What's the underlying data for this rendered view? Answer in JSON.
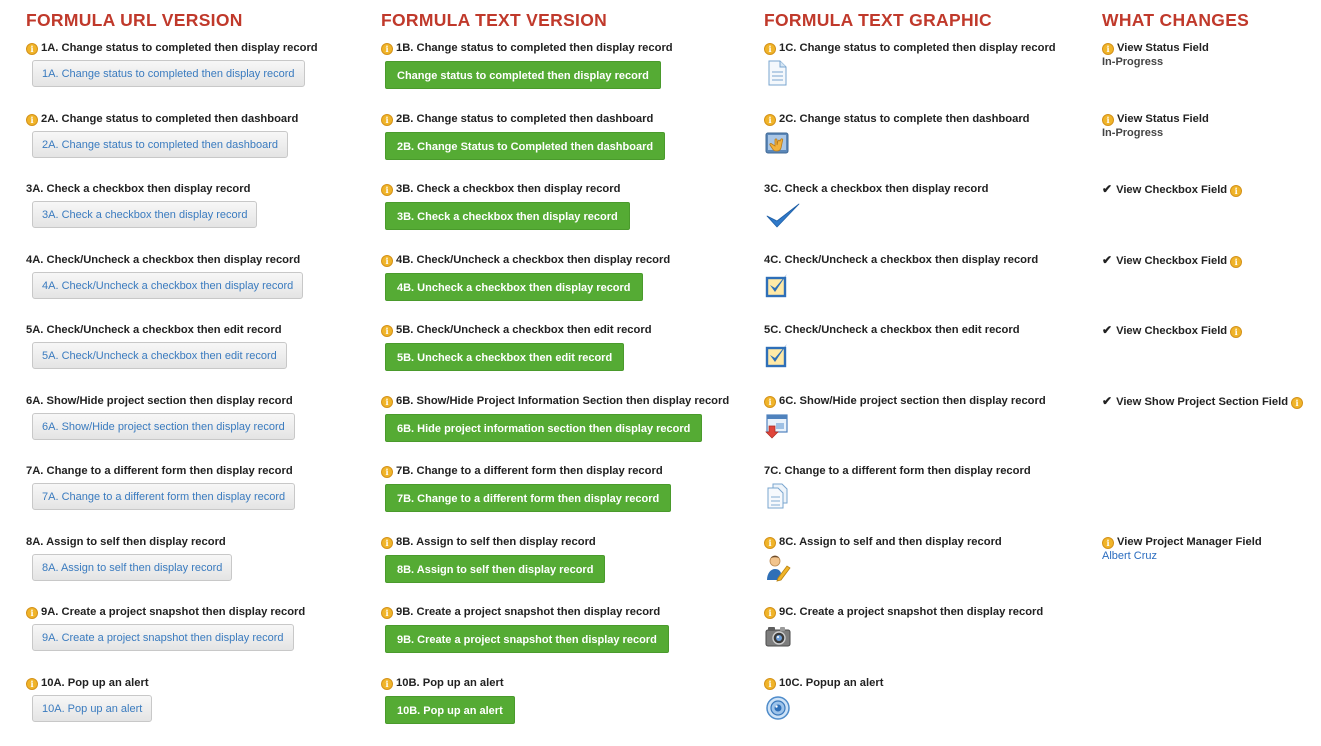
{
  "columns": {
    "url": {
      "title": "FORMULA URL VERSION"
    },
    "text": {
      "title": "FORMULA TEXT VERSION"
    },
    "graphic": {
      "title": "FORMULA TEXT GRAPHIC"
    },
    "changes": {
      "title": "WHAT CHANGES"
    }
  },
  "rows": [
    {
      "url": {
        "label": "1A. Change status to completed then display record",
        "info": true,
        "button": "1A. Change status to completed then display record"
      },
      "text": {
        "label": "1B. Change status to completed then display record",
        "info": true,
        "button": "Change status to completed then display record"
      },
      "graphic": {
        "label": "1C. Change status to completed then display record",
        "info": true,
        "icon": "document-icon"
      },
      "changes": {
        "label": "View Status Field",
        "marker": "info",
        "value": "In-Progress",
        "value_style": "text"
      }
    },
    {
      "url": {
        "label": "2A. Change status to completed then dashboard",
        "info": true,
        "button": "2A. Change status to completed then dashboard"
      },
      "text": {
        "label": "2B. Change status to completed then dashboard",
        "info": true,
        "button": "2B. Change Status to Completed then dashboard"
      },
      "graphic": {
        "label": "2C. Change status to complete then dashboard",
        "info": true,
        "icon": "dashboard-hand-icon"
      },
      "changes": {
        "label": "View Status Field",
        "marker": "info",
        "value": "In-Progress",
        "value_style": "text"
      }
    },
    {
      "url": {
        "label": "3A. Check a checkbox then display record",
        "info": false,
        "button": "3A. Check a checkbox then display record"
      },
      "text": {
        "label": "3B. Check a checkbox then display record",
        "info": true,
        "button": "3B. Check a checkbox then display record"
      },
      "graphic": {
        "label": "3C. Check a checkbox then display record",
        "info": false,
        "icon": "checkmark-icon"
      },
      "changes": {
        "label": "View Checkbox Field",
        "marker": "check"
      }
    },
    {
      "url": {
        "label": "4A. Check/Uncheck a checkbox then display record",
        "info": false,
        "button": "4A. Check/Uncheck a checkbox then display record"
      },
      "text": {
        "label": "4B. Check/Uncheck a checkbox then display record",
        "info": true,
        "button": "4B. Uncheck a checkbox then display record"
      },
      "graphic": {
        "label": "4C. Check/Uncheck a checkbox then display record",
        "info": false,
        "icon": "checked-box-icon"
      },
      "changes": {
        "label": "View Checkbox Field",
        "marker": "check"
      }
    },
    {
      "url": {
        "label": "5A. Check/Uncheck a checkbox then edit record",
        "info": false,
        "button": "5A. Check/Uncheck a checkbox then edit record"
      },
      "text": {
        "label": "5B. Check/Uncheck a checkbox then edit record",
        "info": true,
        "button": "5B. Uncheck a checkbox then edit record"
      },
      "graphic": {
        "label": "5C. Check/Uncheck a checkbox then edit record",
        "info": false,
        "icon": "checked-box-icon"
      },
      "changes": {
        "label": "View Checkbox Field",
        "marker": "check"
      }
    },
    {
      "url": {
        "label": "6A. Show/Hide project section then display record",
        "info": false,
        "button": "6A. Show/Hide project section then display record"
      },
      "text": {
        "label": "6B. Show/Hide Project Information Section then display record",
        "info": true,
        "button": "6B. Hide project information section then display record"
      },
      "graphic": {
        "label": "6C. Show/Hide project section then display record",
        "info": true,
        "icon": "window-arrow-icon"
      },
      "changes": {
        "label": "View Show Project Section Field",
        "marker": "check"
      }
    },
    {
      "url": {
        "label": "7A. Change to a different form then display record",
        "info": false,
        "button": "7A. Change to a different form then display record"
      },
      "text": {
        "label": "7B. Change to a different form then display record",
        "info": true,
        "button": "7B. Change to a different form then display record"
      },
      "graphic": {
        "label": "7C. Change to a different form then display record",
        "info": false,
        "icon": "documents-icon"
      },
      "changes": null
    },
    {
      "url": {
        "label": "8A. Assign to self then display record",
        "info": false,
        "button": "8A. Assign to self then display record"
      },
      "text": {
        "label": "8B. Assign to self then display record",
        "info": true,
        "button": "8B. Assign to self then display record"
      },
      "graphic": {
        "label": "8C. Assign to self and then display record",
        "info": true,
        "icon": "user-edit-icon"
      },
      "changes": {
        "label": "View Project Manager Field",
        "marker": "info",
        "value": "Albert Cruz",
        "value_style": "link"
      }
    },
    {
      "url": {
        "label": "9A. Create a project snapshot then display record",
        "info": true,
        "button": "9A. Create a project snapshot then display record"
      },
      "text": {
        "label": "9B. Create a project snapshot then display record",
        "info": true,
        "button": "9B. Create a project snapshot then display record"
      },
      "graphic": {
        "label": "9C. Create a project snapshot then display record",
        "info": true,
        "icon": "camera-icon"
      },
      "changes": null
    },
    {
      "url": {
        "label": "10A. Pop up an alert",
        "info": true,
        "button": "10A. Pop up an alert"
      },
      "text": {
        "label": "10B. Pop up an alert",
        "info": true,
        "button": "10B. Pop up an alert"
      },
      "graphic": {
        "label": "10C. Popup an alert",
        "info": true,
        "icon": "speaker-icon"
      },
      "changes": null
    }
  ]
}
